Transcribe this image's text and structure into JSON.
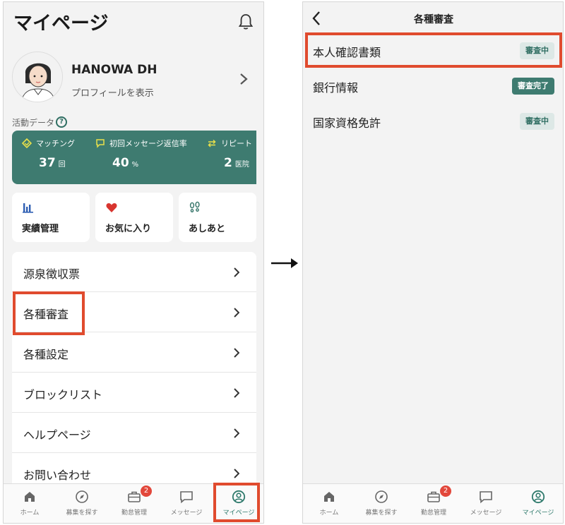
{
  "left": {
    "title": "マイページ",
    "profile": {
      "name": "HANOWA DH",
      "link": "プロフィールを表示"
    },
    "activity_label": "活動データ",
    "stats": [
      {
        "label": "マッチング",
        "value": "37",
        "unit": "回"
      },
      {
        "label": "初回メッセージ返信率",
        "value": "40",
        "unit": "%"
      },
      {
        "label": "リピート",
        "value": "2",
        "unit": "医院"
      }
    ],
    "cards": [
      {
        "label": "実績管理",
        "icon": "bar-chart-icon"
      },
      {
        "label": "お気に入り",
        "icon": "heart-icon"
      },
      {
        "label": "あしあと",
        "icon": "footprints-icon"
      }
    ],
    "menu": [
      "源泉徴収票",
      "各種審査",
      "各種設定",
      "ブロックリスト",
      "ヘルプページ",
      "お問い合わせ"
    ]
  },
  "right": {
    "title": "各種審査",
    "items": [
      {
        "label": "本人確認書類",
        "status": "審査中",
        "state": "pending"
      },
      {
        "label": "銀行情報",
        "status": "審査完了",
        "state": "done"
      },
      {
        "label": "国家資格免許",
        "status": "審査中",
        "state": "pending"
      }
    ]
  },
  "tabs": [
    {
      "label": "ホーム",
      "icon": "home-icon"
    },
    {
      "label": "募集を探す",
      "icon": "compass-icon"
    },
    {
      "label": "勤怠管理",
      "icon": "briefcase-icon",
      "badge": "2"
    },
    {
      "label": "メッセージ",
      "icon": "message-icon"
    },
    {
      "label": "マイページ",
      "icon": "user-circle-icon"
    }
  ],
  "colors": {
    "accent": "#3e7b70",
    "highlight": "#e04b2e",
    "badge": "#e2473b"
  }
}
